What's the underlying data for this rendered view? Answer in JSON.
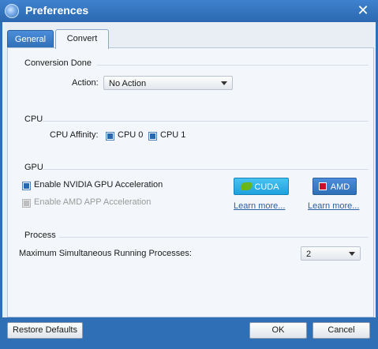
{
  "window": {
    "title": "Preferences",
    "close_icon": "✕"
  },
  "tabs": [
    {
      "label": "General",
      "selected": false
    },
    {
      "label": "Convert",
      "selected": true
    }
  ],
  "conversion_done": {
    "section_title": "Conversion Done",
    "action_label": "Action:",
    "action_value": "No Action"
  },
  "cpu": {
    "section_title": "CPU",
    "affinity_label": "CPU Affinity:",
    "cpu0_label": "CPU 0",
    "cpu0_checked": true,
    "cpu1_label": "CPU 1",
    "cpu1_checked": true
  },
  "gpu": {
    "section_title": "GPU",
    "nvidia_label": "Enable NVIDIA GPU Acceleration",
    "nvidia_checked": true,
    "amd_label": "Enable AMD APP Acceleration",
    "amd_checked": false,
    "amd_disabled": true,
    "cuda_button": "CUDA",
    "amd_button": "AMD",
    "learn_more_cuda": "Learn more...",
    "learn_more_amd": "Learn more..."
  },
  "process": {
    "section_title": "Process",
    "max_label": "Maximum Simultaneous Running Processes:",
    "max_value": "2"
  },
  "buttons": {
    "restore_defaults": "Restore Defaults",
    "ok": "OK",
    "cancel": "Cancel"
  },
  "colors": {
    "titlebar": "#2f6fb5",
    "panel": "#f3f6fa",
    "link": "#2a5fa8"
  }
}
